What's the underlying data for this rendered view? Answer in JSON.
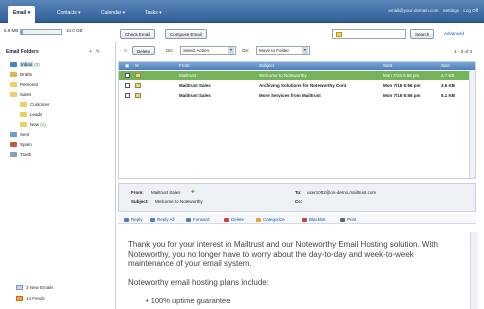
{
  "nav": {
    "tabs": [
      "Email ▾",
      "Contacts ▾",
      "Calendar ▾",
      "Tasks ▾"
    ],
    "user": "email@your-domain.com",
    "settings": "Settings",
    "logout": "Log Off"
  },
  "quota": {
    "used": "5.9 MB",
    "total": "10.0 GB",
    "fill_fraction": 0.06
  },
  "top_buttons": {
    "check": "Check Email",
    "compose": "Compose Email",
    "search": "Search",
    "advanced": "Advanced"
  },
  "sidebar": {
    "title": "Email Folders",
    "add_icon": "+",
    "edit_icon": "✎",
    "folders": [
      {
        "label": "Inbox",
        "count": "(2)",
        "icon": "inbox-icon",
        "selected": true
      },
      {
        "label": "Drafts",
        "count": "",
        "icon": "drafts-icon"
      },
      {
        "label": "Personal",
        "count": "",
        "icon": "folder-icon"
      },
      {
        "label": "Sales",
        "count": "",
        "icon": "folder-icon"
      },
      {
        "label": "Customer",
        "count": "",
        "icon": "folder-icon"
      },
      {
        "label": "Leads",
        "count": "",
        "icon": "folder-icon"
      },
      {
        "label": "New",
        "count": "(1)",
        "icon": "folder-icon"
      },
      {
        "label": "Sent",
        "count": "",
        "icon": "sent-icon"
      },
      {
        "label": "Spam",
        "count": "",
        "icon": "spam-icon"
      },
      {
        "label": "Trash",
        "count": "",
        "icon": "trash-icon"
      }
    ],
    "footer": [
      "3 New Emails",
      "14 Feeds"
    ]
  },
  "toolbar": {
    "delete": "Delete",
    "on1": "On:",
    "select_action": "Select Action",
    "on2": "On:",
    "move_to": "Move to Folder",
    "paging": "1 - 3 of 3"
  },
  "list": {
    "headers": {
      "from": "From",
      "subject": "Subject",
      "sent": "Sent",
      "size": "Size"
    },
    "rows": [
      {
        "from": "Mailtrust",
        "subject": "Welcome to Noteworthy",
        "sent": "Mon 7/15 6:58 pm",
        "size": "4.7 KB",
        "selected": true,
        "bold": false
      },
      {
        "from": "Mailtrust Sales",
        "subject": "Archiving Solutions for Noteworthy Cont",
        "sent": "Mon 7/15 6:56 pm",
        "size": "3.6 KB",
        "selected": false,
        "bold": true
      },
      {
        "from": "Mailtrust Sales",
        "subject": "More Services from Mailtrust",
        "sent": "Mon 7/15 6:56 pm",
        "size": "5.1 KB",
        "selected": false,
        "bold": true
      }
    ]
  },
  "preview": {
    "from_label": "From:",
    "from": "Mailtrust Sales",
    "to_label": "To:",
    "to": "user1002@on-demo.mailtrust.com",
    "subject_label": "Subject:",
    "subject": "Welcome to Noteworthy",
    "cc_label": "Cc:",
    "actions": [
      "Reply",
      "Reply All",
      "Forward",
      "Delete",
      "Categorize",
      "Blacklist",
      "Print"
    ],
    "body_lines": [
      "Thank you for your interest in Mailtrust and our Noteworthy Email Hosting solution. With",
      "Noteworthy, you no longer have to worry about the day-to-day and week-to-week",
      "maintenance of your email system."
    ],
    "body_line2": "Noteworthy email hosting plans include:",
    "bullet": "100% uptime guarantee"
  },
  "colors": {
    "nav": "#2f5f97",
    "selected_row": "#74b35a",
    "link": "#1a55a8"
  }
}
